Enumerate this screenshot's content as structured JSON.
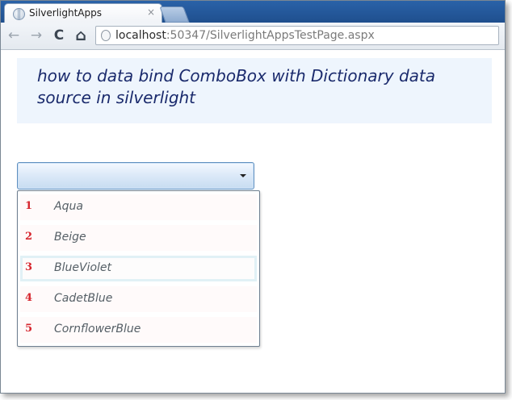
{
  "browser": {
    "tab_title": "SilverlightApps",
    "tab_close": "×",
    "url_host": "localhost",
    "url_rest": ":50347/SilverlightAppsTestPage.aspx",
    "icons": {
      "back": "←",
      "forward": "→",
      "reload": "C",
      "home": "⌂"
    }
  },
  "page": {
    "heading": "how to data bind ComboBox with Dictionary data source in silverlight",
    "combobox": {
      "selected_value": "",
      "options": [
        {
          "key": "1",
          "value": "Aqua"
        },
        {
          "key": "2",
          "value": "Beige"
        },
        {
          "key": "3",
          "value": "BlueViolet"
        },
        {
          "key": "4",
          "value": "CadetBlue"
        },
        {
          "key": "5",
          "value": "CornflowerBlue"
        }
      ],
      "highlighted_index": 2
    }
  },
  "colors": {
    "heading_text": "#1a2a6c",
    "heading_bg": "#eef5fd",
    "key_text": "#d6262e",
    "value_text": "#555f66",
    "combo_border": "#5f8fbf"
  }
}
